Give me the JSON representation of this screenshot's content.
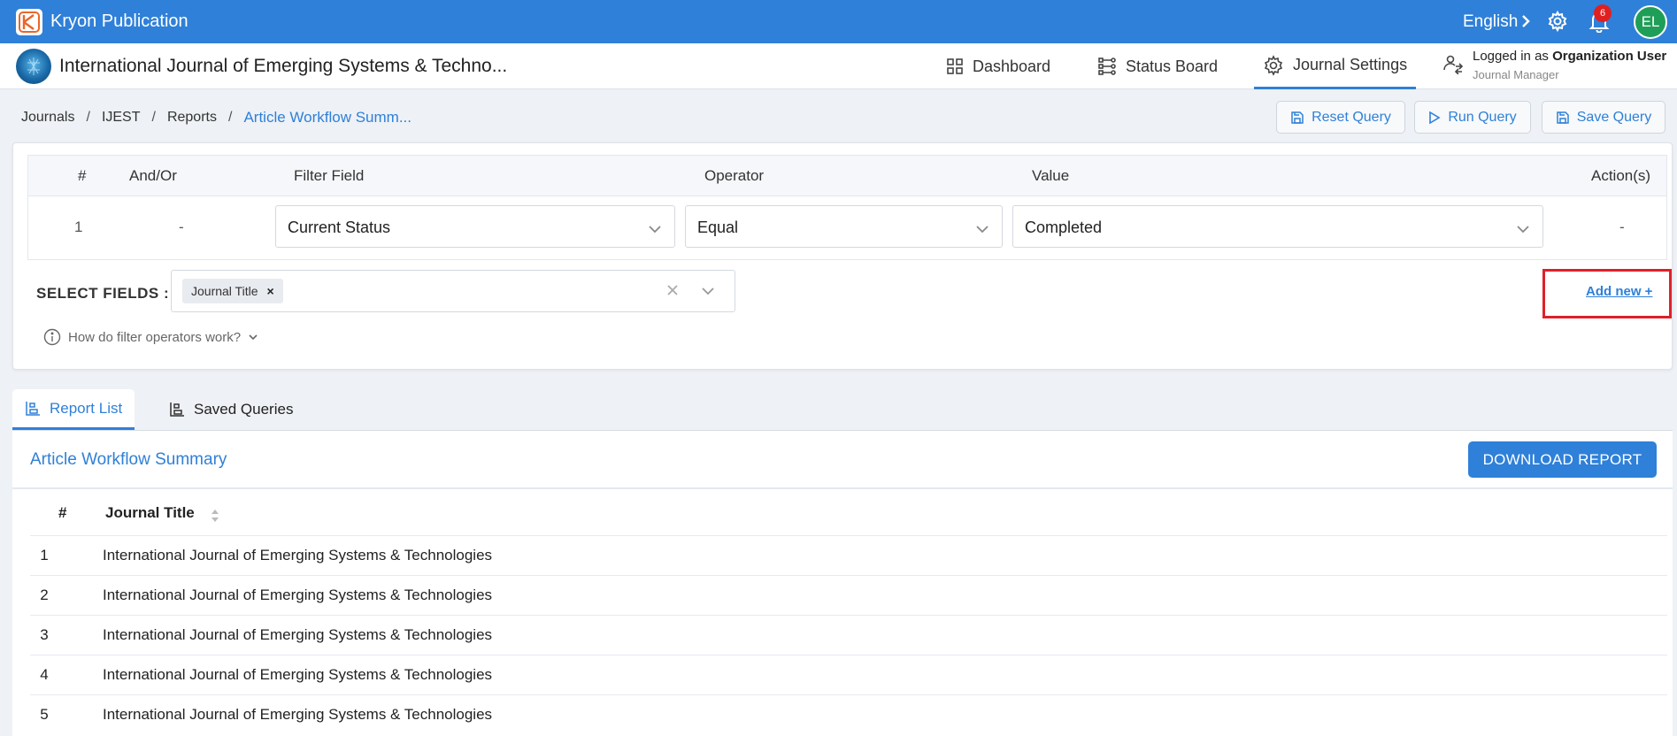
{
  "app": {
    "title": "Kryon Publication",
    "language": "English",
    "notifications_count": "6",
    "avatar_initials": "EL"
  },
  "journal": {
    "title": "International Journal of Emerging Systems & Techno..."
  },
  "nav": {
    "dashboard": "Dashboard",
    "status_board": "Status Board",
    "journal_settings": "Journal Settings"
  },
  "user": {
    "logged_in_prefix": "Logged in as",
    "name": "Organization User",
    "role": "Journal Manager"
  },
  "breadcrumb": {
    "items": [
      "Journals",
      "IJEST",
      "Reports"
    ],
    "current": "Article Workflow Summ..."
  },
  "query_buttons": {
    "reset": "Reset Query",
    "run": "Run Query",
    "save": "Save Query"
  },
  "filter_table": {
    "headers": {
      "num": "#",
      "and_or": "And/Or",
      "filter_field": "Filter Field",
      "operator": "Operator",
      "value": "Value",
      "actions": "Action(s)"
    },
    "rows": [
      {
        "num": "1",
        "and_or": "-",
        "filter_field": "Current Status",
        "operator": "Equal",
        "value": "Completed",
        "actions": "-"
      }
    ]
  },
  "select_fields": {
    "label": "SELECT FIELDS :",
    "chips": [
      "Journal Title"
    ]
  },
  "add_new": "Add new +",
  "help_text": "How do filter operators work?",
  "tabs": {
    "report_list": "Report List",
    "saved_queries": "Saved Queries"
  },
  "report": {
    "title": "Article Workflow Summary",
    "download_label": "DOWNLOAD REPORT",
    "columns": {
      "num": "#",
      "journal_title": "Journal Title"
    },
    "rows": [
      {
        "num": "1",
        "title": "International Journal of Emerging Systems & Technologies"
      },
      {
        "num": "2",
        "title": "International Journal of Emerging Systems & Technologies"
      },
      {
        "num": "3",
        "title": "International Journal of Emerging Systems & Technologies"
      },
      {
        "num": "4",
        "title": "International Journal of Emerging Systems & Technologies"
      },
      {
        "num": "5",
        "title": "International Journal of Emerging Systems & Technologies"
      }
    ]
  },
  "colors": {
    "primary": "#2f80d8",
    "highlight": "#e0202a",
    "avatar": "#1f9e57",
    "badge": "#e02020"
  }
}
